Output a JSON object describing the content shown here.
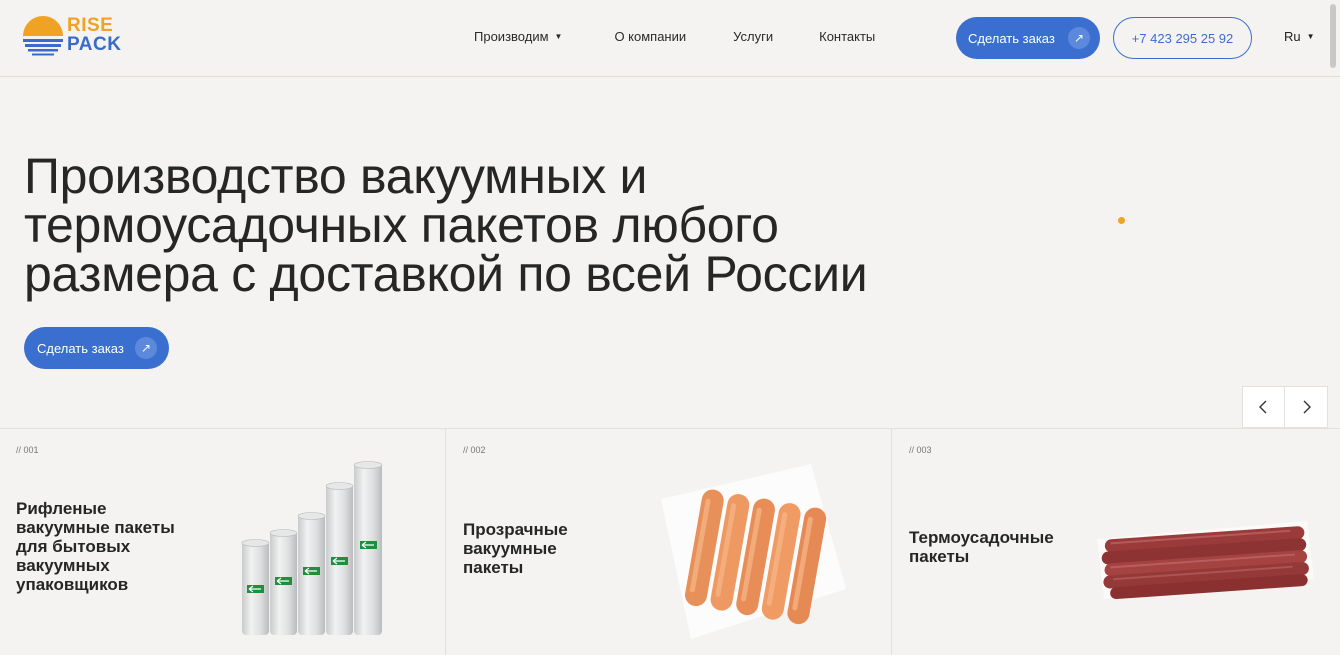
{
  "logo": {
    "line1": "RISE",
    "line2": "PACK"
  },
  "nav": {
    "items": [
      {
        "label": "Производим",
        "has_dropdown": true
      },
      {
        "label": "О компании",
        "has_dropdown": false
      },
      {
        "label": "Услуги",
        "has_dropdown": false
      },
      {
        "label": "Контакты",
        "has_dropdown": false
      }
    ]
  },
  "header": {
    "order_button": "Сделать заказ",
    "phone": "+7 423 295 25 92",
    "language": "Ru"
  },
  "hero": {
    "title": "Производство вакуумных и термоусадочных пакетов любого размера с доставкой по всей России",
    "order_button": "Сделать заказ"
  },
  "cards": [
    {
      "num": "// 001",
      "title": "Рифленые вакуумные пакеты для бытовых вакуумных упаковщиков",
      "image": "film-rolls"
    },
    {
      "num": "// 002",
      "title": "Прозрачные вакуумные пакеты",
      "image": "vacuum-sausages"
    },
    {
      "num": "// 003",
      "title": "Термоусадочные пакеты",
      "image": "shrink-sausages"
    }
  ],
  "colors": {
    "accent_blue": "#3a6fd0",
    "accent_orange": "#f0a224",
    "background": "#f4f3f1"
  }
}
